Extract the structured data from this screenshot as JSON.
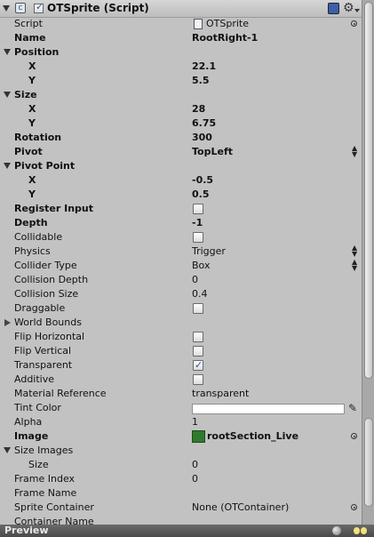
{
  "header": {
    "title": "OTSprite (Script)",
    "enabled": true
  },
  "fields": {
    "script": {
      "label": "Script",
      "value": "OTSprite"
    },
    "name": {
      "label": "Name",
      "value": "RootRight-1"
    },
    "position": {
      "label": "Position",
      "x_label": "X",
      "x": "22.1",
      "y_label": "Y",
      "y": "5.5"
    },
    "size": {
      "label": "Size",
      "x_label": "X",
      "x": "28",
      "y_label": "Y",
      "y": "6.75"
    },
    "rotation": {
      "label": "Rotation",
      "value": "300"
    },
    "pivot": {
      "label": "Pivot",
      "value": "TopLeft"
    },
    "pivot_point": {
      "label": "Pivot Point",
      "x_label": "X",
      "x": "-0.5",
      "y_label": "Y",
      "y": "0.5"
    },
    "register_input": {
      "label": "Register Input",
      "checked": false
    },
    "depth": {
      "label": "Depth",
      "value": "-1"
    },
    "collidable": {
      "label": "Collidable",
      "checked": false
    },
    "physics": {
      "label": "Physics",
      "value": "Trigger"
    },
    "collider_type": {
      "label": "Collider Type",
      "value": "Box"
    },
    "collision_depth": {
      "label": "Collision Depth",
      "value": "0"
    },
    "collision_size": {
      "label": "Collision Size",
      "value": "0.4"
    },
    "draggable": {
      "label": "Draggable",
      "checked": false
    },
    "world_bounds": {
      "label": "World Bounds"
    },
    "flip_horizontal": {
      "label": "Flip Horizontal",
      "checked": false
    },
    "flip_vertical": {
      "label": "Flip Vertical",
      "checked": false
    },
    "transparent": {
      "label": "Transparent",
      "checked": true
    },
    "additive": {
      "label": "Additive",
      "checked": false
    },
    "material_reference": {
      "label": "Material Reference",
      "value": "transparent"
    },
    "tint_color": {
      "label": "Tint Color",
      "color": "#ffffff"
    },
    "alpha": {
      "label": "Alpha",
      "value": "1"
    },
    "image": {
      "label": "Image",
      "value": "rootSection_Live"
    },
    "size_images": {
      "label": "Size Images",
      "size_label": "Size",
      "size": "0"
    },
    "frame_index": {
      "label": "Frame Index",
      "value": "0"
    },
    "frame_name": {
      "label": "Frame Name",
      "value": ""
    },
    "sprite_container": {
      "label": "Sprite Container",
      "value": "None (OTContainer)"
    },
    "container_name": {
      "label": "Container Name"
    }
  },
  "footer": {
    "title": "Preview"
  }
}
